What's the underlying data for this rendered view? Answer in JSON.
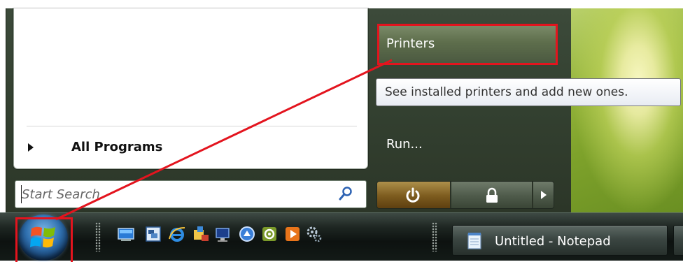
{
  "start_menu": {
    "all_programs_label": "All Programs",
    "search_placeholder": "Start Search",
    "right_items": {
      "printers": "Printers",
      "run": "Run..."
    },
    "tooltip": "See installed printers and add new ones."
  },
  "taskbar": {
    "quick_launch_icons": [
      "show-desktop-icon",
      "switch-windows-icon",
      "internet-explorer-icon",
      "folder-network-icon",
      "computer-icon",
      "media-center-icon",
      "webcam-icon",
      "media-player-icon",
      "settings-gears-icon"
    ],
    "task_buttons": [
      {
        "label": "Untitled - Notepad",
        "icon": "notepad-icon"
      }
    ]
  },
  "annotation": {
    "color": "#e3141e"
  }
}
